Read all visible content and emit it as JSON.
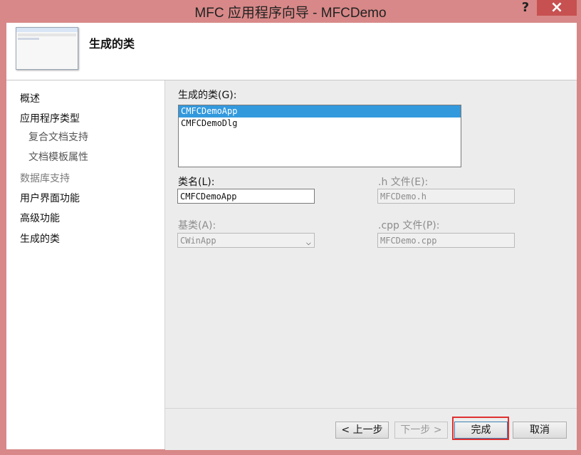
{
  "window": {
    "title": "MFC 应用程序向导 - MFCDemo",
    "help": "?",
    "close": "×"
  },
  "header": {
    "title": "生成的类"
  },
  "sidebar": {
    "items": [
      {
        "label": "概述"
      },
      {
        "label": "应用程序类型"
      },
      {
        "label": "复合文档支持"
      },
      {
        "label": "文档模板属性"
      },
      {
        "label": "数据库支持"
      },
      {
        "label": "用户界面功能"
      },
      {
        "label": "高级功能"
      },
      {
        "label": "生成的类"
      }
    ]
  },
  "main": {
    "classes_label": "生成的类(G):",
    "classes": [
      "CMFCDemoApp",
      "CMFCDemoDlg"
    ],
    "class_name_label": "类名(L):",
    "class_name_value": "CMFCDemoApp",
    "h_file_label": ".h 文件(E):",
    "h_file_value": "MFCDemo.h",
    "base_class_label": "基类(A):",
    "base_class_value": "CWinApp",
    "cpp_file_label": ".cpp 文件(P):",
    "cpp_file_value": "MFCDemo.cpp"
  },
  "footer": {
    "prev": "< 上一步",
    "next": "下一步 >",
    "finish": "完成",
    "cancel": "取消"
  }
}
